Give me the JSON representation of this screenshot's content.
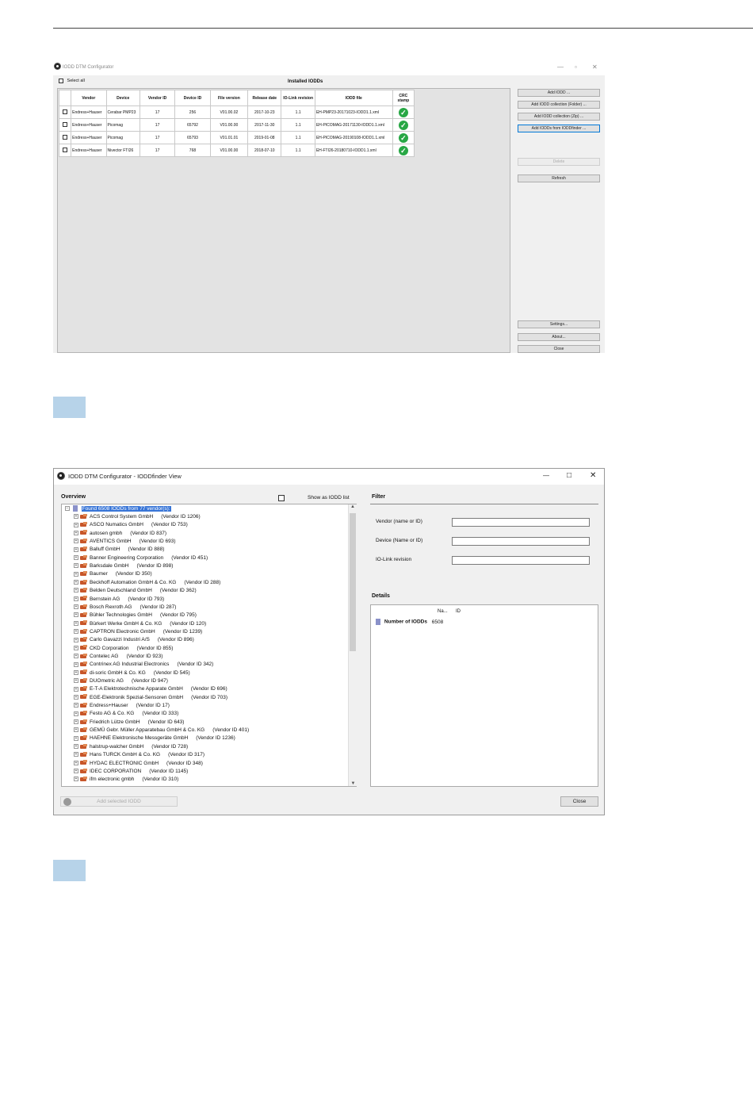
{
  "window1": {
    "title": "IODD DTM Configurator",
    "select_all": "Select all",
    "installed_heading": "Installed IODDs",
    "columns": [
      "",
      "Vendor",
      "Device",
      "Vendor ID",
      "Device ID",
      "File version",
      "Release date",
      "IO-Link revision",
      "IODD file",
      "CRC stamp"
    ],
    "rows": [
      {
        "vendor": "Endress+Hauser",
        "device": "Cerabar PMP23",
        "vendor_id": "17",
        "device_id": "256",
        "file_version": "V01.00.02",
        "release_date": "2017-10-23",
        "iolink_rev": "1.1",
        "iodd_file": "EH-PMP23-20171023-IODD1.1.xml"
      },
      {
        "vendor": "Endress+Hauser",
        "device": "Picomag",
        "vendor_id": "17",
        "device_id": "65792",
        "file_version": "V01.00.00",
        "release_date": "2017-11-30",
        "iolink_rev": "1.1",
        "iodd_file": "EH-PICOMAG-20171130-IODD1.1.xml"
      },
      {
        "vendor": "Endress+Hauser",
        "device": "Picomag",
        "vendor_id": "17",
        "device_id": "65793",
        "file_version": "V01.01.01",
        "release_date": "2019-01-08",
        "iolink_rev": "1.1",
        "iodd_file": "EH-PICOMAG-20190108-IODD1.1.xml"
      },
      {
        "vendor": "Endress+Hauser",
        "device": "Nivector FTI26",
        "vendor_id": "17",
        "device_id": "768",
        "file_version": "V01.00.00",
        "release_date": "2018-07-10",
        "iolink_rev": "1.1",
        "iodd_file": "EH-FTI26-20180710-IODD1.1.xml"
      }
    ],
    "buttons": {
      "add_iodd": "Add IODD ...",
      "add_folder": "Add IODD collection (Folder) ...",
      "add_zip": "Add IODD collection (Zip) ...",
      "add_finder": "Add IODDs from IODDfinder ...",
      "delete": "Delete",
      "refresh": "Refresh",
      "settings": "Settings...",
      "about": "About...",
      "close": "Close"
    }
  },
  "window2": {
    "title": "IODD DTM Configurator - IODDfinder View",
    "overview_label": "Overview",
    "show_as_list": "Show as IODD list",
    "filter_label": "Filter",
    "tree_root": "Found 6508 IODDs from 77 vendor(s):",
    "vendors": [
      {
        "name": "ACS Control System GmbH",
        "id": "(Vendor ID 1206)"
      },
      {
        "name": "ASCO Numatics GmbH",
        "id": "(Vendor ID 753)"
      },
      {
        "name": "autosen gmbh",
        "id": "(Vendor ID 837)"
      },
      {
        "name": "AVENTICS GmbH",
        "id": "(Vendor ID 693)"
      },
      {
        "name": "Balluff GmbH",
        "id": "(Vendor ID 888)"
      },
      {
        "name": "Banner Engineering Corporation",
        "id": "(Vendor ID 451)"
      },
      {
        "name": "Barksdale GmbH",
        "id": "(Vendor ID 898)"
      },
      {
        "name": "Baumer",
        "id": "(Vendor ID 350)"
      },
      {
        "name": "Beckhoff Automation GmbH & Co. KG",
        "id": "(Vendor ID 288)"
      },
      {
        "name": "Belden Deutschland GmbH",
        "id": "(Vendor ID 362)"
      },
      {
        "name": "Bernstein AG",
        "id": "(Vendor ID 793)"
      },
      {
        "name": "Bosch Rexroth AG",
        "id": "(Vendor ID 287)"
      },
      {
        "name": "Bühler Technologies GmbH",
        "id": "(Vendor ID 795)"
      },
      {
        "name": "Bürkert Werke GmbH & Co. KG",
        "id": "(Vendor ID 120)"
      },
      {
        "name": "CAPTRON Electronic GmbH",
        "id": "(Vendor ID 1239)"
      },
      {
        "name": "Carlo Gavazzi Industri A/S",
        "id": "(Vendor ID 896)"
      },
      {
        "name": "CKD Corporation",
        "id": "(Vendor ID 855)"
      },
      {
        "name": "Contelec AG",
        "id": "(Vendor ID 923)"
      },
      {
        "name": "Contrinex AG Industrial Electronics",
        "id": "(Vendor ID 342)"
      },
      {
        "name": "di-soric GmbH & Co. KG",
        "id": "(Vendor ID 545)"
      },
      {
        "name": "DUOmetric AG",
        "id": "(Vendor ID 947)"
      },
      {
        "name": "E-T-A Elektrotechnische Apparate GmbH",
        "id": "(Vendor ID 696)"
      },
      {
        "name": "EGE-Elektronik Spezial-Sensoren GmbH",
        "id": "(Vendor ID 703)"
      },
      {
        "name": "Endress+Hauser",
        "id": "(Vendor ID 17)"
      },
      {
        "name": "Festo AG & Co. KG",
        "id": "(Vendor ID 333)"
      },
      {
        "name": "Friedrich Lütze GmbH",
        "id": "(Vendor ID 643)"
      },
      {
        "name": "GEMÜ Gebr. Müller Apparatebau GmbH & Co. KG",
        "id": "(Vendor ID 401)"
      },
      {
        "name": "HAEHNE Elektronische Messgeräte GmbH",
        "id": "(Vendor ID 1236)"
      },
      {
        "name": "halstrup-walcher GmbH",
        "id": "(Vendor ID 728)"
      },
      {
        "name": "Hans TURCK GmbH & Co. KG",
        "id": "(Vendor ID 317)"
      },
      {
        "name": "HYDAC ELECTRONIC GmbH",
        "id": "(Vendor ID 348)"
      },
      {
        "name": "IDEC CORPORATION",
        "id": "(Vendor ID 1145)"
      },
      {
        "name": "ifm electronic gmbh",
        "id": "(Vendor ID 310)"
      }
    ],
    "filter_fields": [
      "Vendor (name or ID)",
      "Device (Name or ID)",
      "IO-Link revision"
    ],
    "details_label": "Details",
    "details_columns": [
      "Na...",
      "ID"
    ],
    "details_row": {
      "name": "Number of IODDs",
      "value": "6508"
    },
    "add_selected": "Add selected IODD",
    "close": "Close"
  }
}
